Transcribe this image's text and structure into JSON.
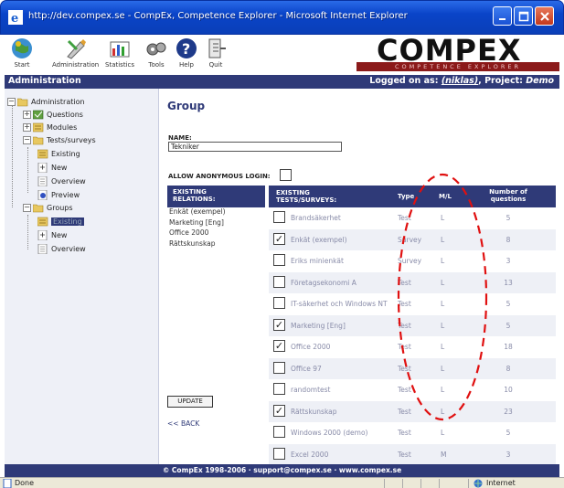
{
  "window": {
    "title": "http://dev.compex.se - CompEx, Competence Explorer - Microsoft Internet Explorer"
  },
  "toolbar": {
    "items": [
      {
        "label": "Start",
        "icon": "start-icon"
      },
      {
        "label": "Administration",
        "icon": "administration-icon"
      },
      {
        "label": "Statistics",
        "icon": "statistics-icon"
      },
      {
        "label": "Tools",
        "icon": "tools-icon"
      },
      {
        "label": "Help",
        "icon": "help-icon"
      },
      {
        "label": "Quit",
        "icon": "quit-icon"
      }
    ],
    "logo": "COMPEX",
    "logo_sub": "COMPETENCE EXPLORER"
  },
  "header": {
    "section": "Administration",
    "logged_prefix": "Logged on as: ",
    "user": "(niklas)",
    "project_prefix": ", Project: ",
    "project": "Demo"
  },
  "sidebar": {
    "items": [
      {
        "label": "Administration"
      },
      {
        "label": "Questions"
      },
      {
        "label": "Modules"
      },
      {
        "label": "Tests/surveys"
      },
      {
        "label": "Existing"
      },
      {
        "label": "New"
      },
      {
        "label": "Overview"
      },
      {
        "label": "Preview"
      },
      {
        "label": "Groups"
      },
      {
        "label": "Existing"
      },
      {
        "label": "New"
      },
      {
        "label": "Overview"
      }
    ]
  },
  "main": {
    "title": "Group",
    "name_label": "NAME:",
    "name_value": "Tekniker",
    "anon_label": "ALLOW ANONYMOUS LOGIN:",
    "relations_header_1": "EXISTING",
    "relations_header_2": "RELATIONS:",
    "relations": [
      "Enkät (exempel)",
      "Marketing [Eng]",
      "Office 2000",
      "Rättskunskap"
    ],
    "tests_header_1": "EXISTING",
    "tests_header_2": "TESTS/SURVEYS:",
    "col_type": "Type",
    "col_ml": "M/L",
    "col_nq_1": "Number of",
    "col_nq_2": "questions",
    "tests": [
      {
        "name": "Brandsäkerhet",
        "type": "Test",
        "ml": "L",
        "nq": "5",
        "checked": false
      },
      {
        "name": "Enkät (exempel)",
        "type": "Survey",
        "ml": "L",
        "nq": "8",
        "checked": true
      },
      {
        "name": "Eriks minienkät",
        "type": "Survey",
        "ml": "L",
        "nq": "3",
        "checked": false
      },
      {
        "name": "Företagsekonomi A",
        "type": "Test",
        "ml": "L",
        "nq": "13",
        "checked": false
      },
      {
        "name": "IT-säkerhet och Windows NT",
        "type": "Test",
        "ml": "L",
        "nq": "5",
        "checked": false
      },
      {
        "name": "Marketing [Eng]",
        "type": "Test",
        "ml": "L",
        "nq": "5",
        "checked": true
      },
      {
        "name": "Office 2000",
        "type": "Test",
        "ml": "L",
        "nq": "18",
        "checked": true
      },
      {
        "name": "Office 97",
        "type": "Test",
        "ml": "L",
        "nq": "8",
        "checked": false
      },
      {
        "name": "randomtest",
        "type": "Test",
        "ml": "L",
        "nq": "10",
        "checked": false
      },
      {
        "name": "Rättskunskap",
        "type": "Test",
        "ml": "L",
        "nq": "23",
        "checked": true
      },
      {
        "name": "Windows 2000 (demo)",
        "type": "Test",
        "ml": "L",
        "nq": "5",
        "checked": false
      },
      {
        "name": "Excel 2000",
        "type": "Test",
        "ml": "M",
        "nq": "3",
        "checked": false
      }
    ],
    "update_label": "UPDATE",
    "back_label": "<< BACK"
  },
  "footer": {
    "text": "© CompEx 1998-2006 · support@compex.se · www.compex.se"
  },
  "status": {
    "done": "Done",
    "zone": "Internet"
  },
  "colors": {
    "navy": "#2f3a78",
    "annotation": "#e01010"
  }
}
